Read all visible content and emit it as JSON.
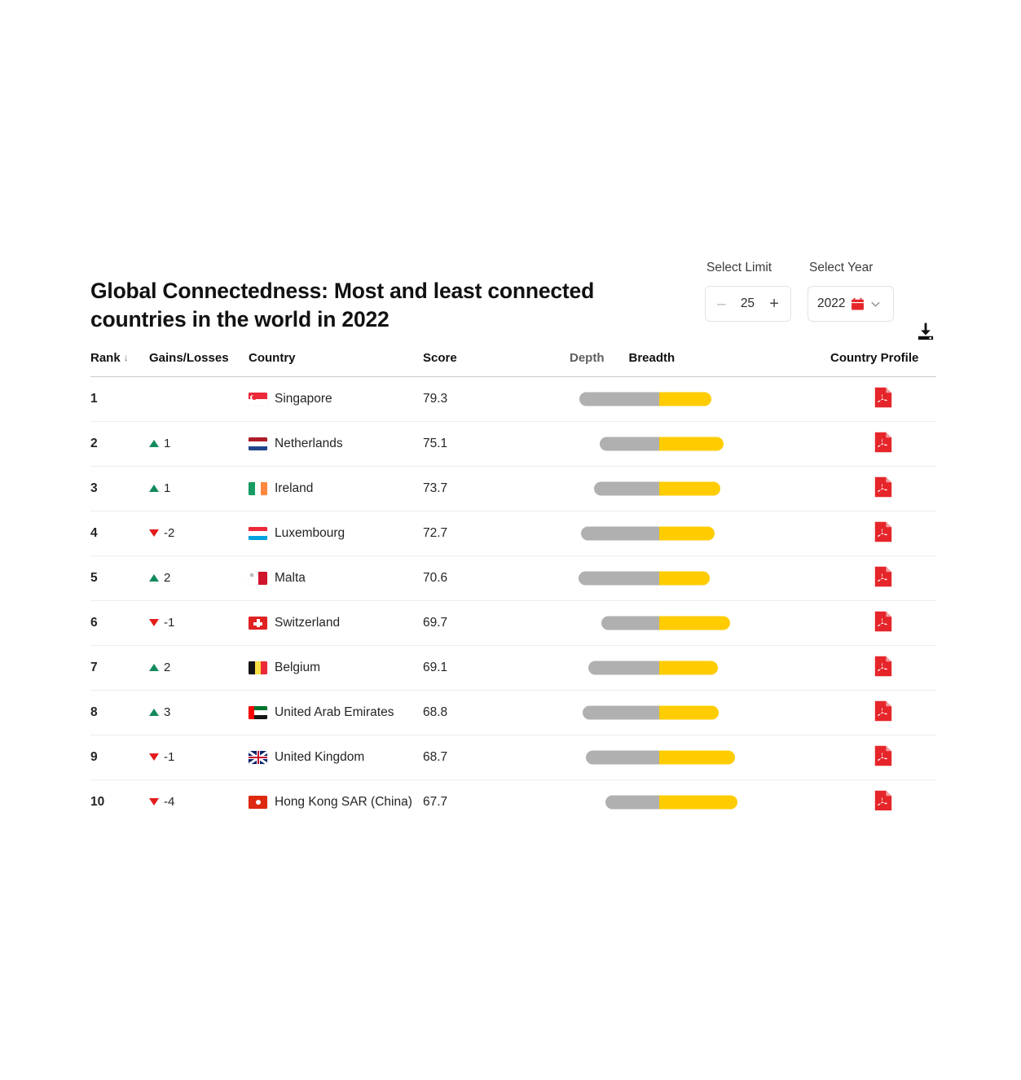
{
  "header": {
    "title": "Global Connectedness: Most and least connected countries in the world in 2022"
  },
  "controls": {
    "limit": {
      "label": "Select Limit",
      "value": "25",
      "decrement_label": "–",
      "increment_label": "+"
    },
    "year": {
      "label": "Select Year",
      "value": "2022",
      "calendar_icon": "calendar-icon",
      "chevron_icon": "chevron-down-icon"
    },
    "download": {
      "icon": "download-icon"
    }
  },
  "table": {
    "columns": {
      "rank": "Rank",
      "rank_sort_arrow": "↓",
      "change": "Gains/Losses",
      "country": "Country",
      "score": "Score",
      "depth": "Depth",
      "breadth": "Breadth",
      "profile": "Country Profile"
    },
    "rows": [
      {
        "rank": "1",
        "change": "",
        "direction": "none",
        "country": "Singapore",
        "flag": "sg",
        "score": "79.3",
        "profile": "pdf-icon"
      },
      {
        "rank": "2",
        "change": "1",
        "direction": "up",
        "country": "Netherlands",
        "flag": "nl",
        "score": "75.1",
        "profile": "pdf-icon"
      },
      {
        "rank": "3",
        "change": "1",
        "direction": "up",
        "country": "Ireland",
        "flag": "ie",
        "score": "73.7",
        "profile": "pdf-icon"
      },
      {
        "rank": "4",
        "change": "-2",
        "direction": "down",
        "country": "Luxembourg",
        "flag": "lu",
        "score": "72.7",
        "profile": "pdf-icon"
      },
      {
        "rank": "5",
        "change": "2",
        "direction": "up",
        "country": "Malta",
        "flag": "mt",
        "score": "70.6",
        "profile": "pdf-icon"
      },
      {
        "rank": "6",
        "change": "-1",
        "direction": "down",
        "country": "Switzerland",
        "flag": "ch",
        "score": "69.7",
        "profile": "pdf-icon"
      },
      {
        "rank": "7",
        "change": "2",
        "direction": "up",
        "country": "Belgium",
        "flag": "be",
        "score": "69.1",
        "profile": "pdf-icon"
      },
      {
        "rank": "8",
        "change": "3",
        "direction": "up",
        "country": "United Arab Emirates",
        "flag": "ae",
        "score": "68.8",
        "profile": "pdf-icon"
      },
      {
        "rank": "9",
        "change": "-1",
        "direction": "down",
        "country": "United Kingdom",
        "flag": "gb",
        "score": "68.7",
        "profile": "pdf-icon"
      },
      {
        "rank": "10",
        "change": "-4",
        "direction": "down",
        "country": "Hong Kong SAR (China)",
        "flag": "hk",
        "score": "67.7",
        "profile": "pdf-icon"
      }
    ]
  },
  "chart_data": {
    "type": "bar",
    "title": "Global Connectedness: Most and least connected countries in the world in 2022",
    "subtitle": "",
    "xlabel": "",
    "ylabel": "",
    "orientation": "horizontal-diverging",
    "legend": [
      "Depth",
      "Breadth"
    ],
    "legend_position": "column-header",
    "grid": false,
    "colors": {
      "depth": "#b0b0b0",
      "breadth": "#ffcc00",
      "up": "#128a5b",
      "down": "#e21b1b",
      "pdf": "#e5252a"
    },
    "categories": [
      "Singapore",
      "Netherlands",
      "Ireland",
      "Luxembourg",
      "Malta",
      "Switzerland",
      "Belgium",
      "United Arab Emirates",
      "United Kingdom",
      "Hong Kong SAR (China)"
    ],
    "scores": [
      79.3,
      75.1,
      73.7,
      72.7,
      70.6,
      69.7,
      69.1,
      68.8,
      68.7,
      67.7
    ],
    "ranks": [
      1,
      2,
      3,
      4,
      5,
      6,
      7,
      8,
      9,
      10
    ],
    "rank_changes": [
      null,
      1,
      1,
      -2,
      2,
      -1,
      2,
      3,
      -1,
      -4
    ],
    "series": [
      {
        "name": "Depth",
        "values": [
          98,
          73,
          80,
          96,
          99,
          71,
          87,
          94,
          90,
          66
        ]
      },
      {
        "name": "Breadth",
        "values": [
          64,
          79,
          75,
          68,
          62,
          87,
          72,
          73,
          93,
          96
        ]
      }
    ],
    "bar_units": "pixels-from-center"
  }
}
